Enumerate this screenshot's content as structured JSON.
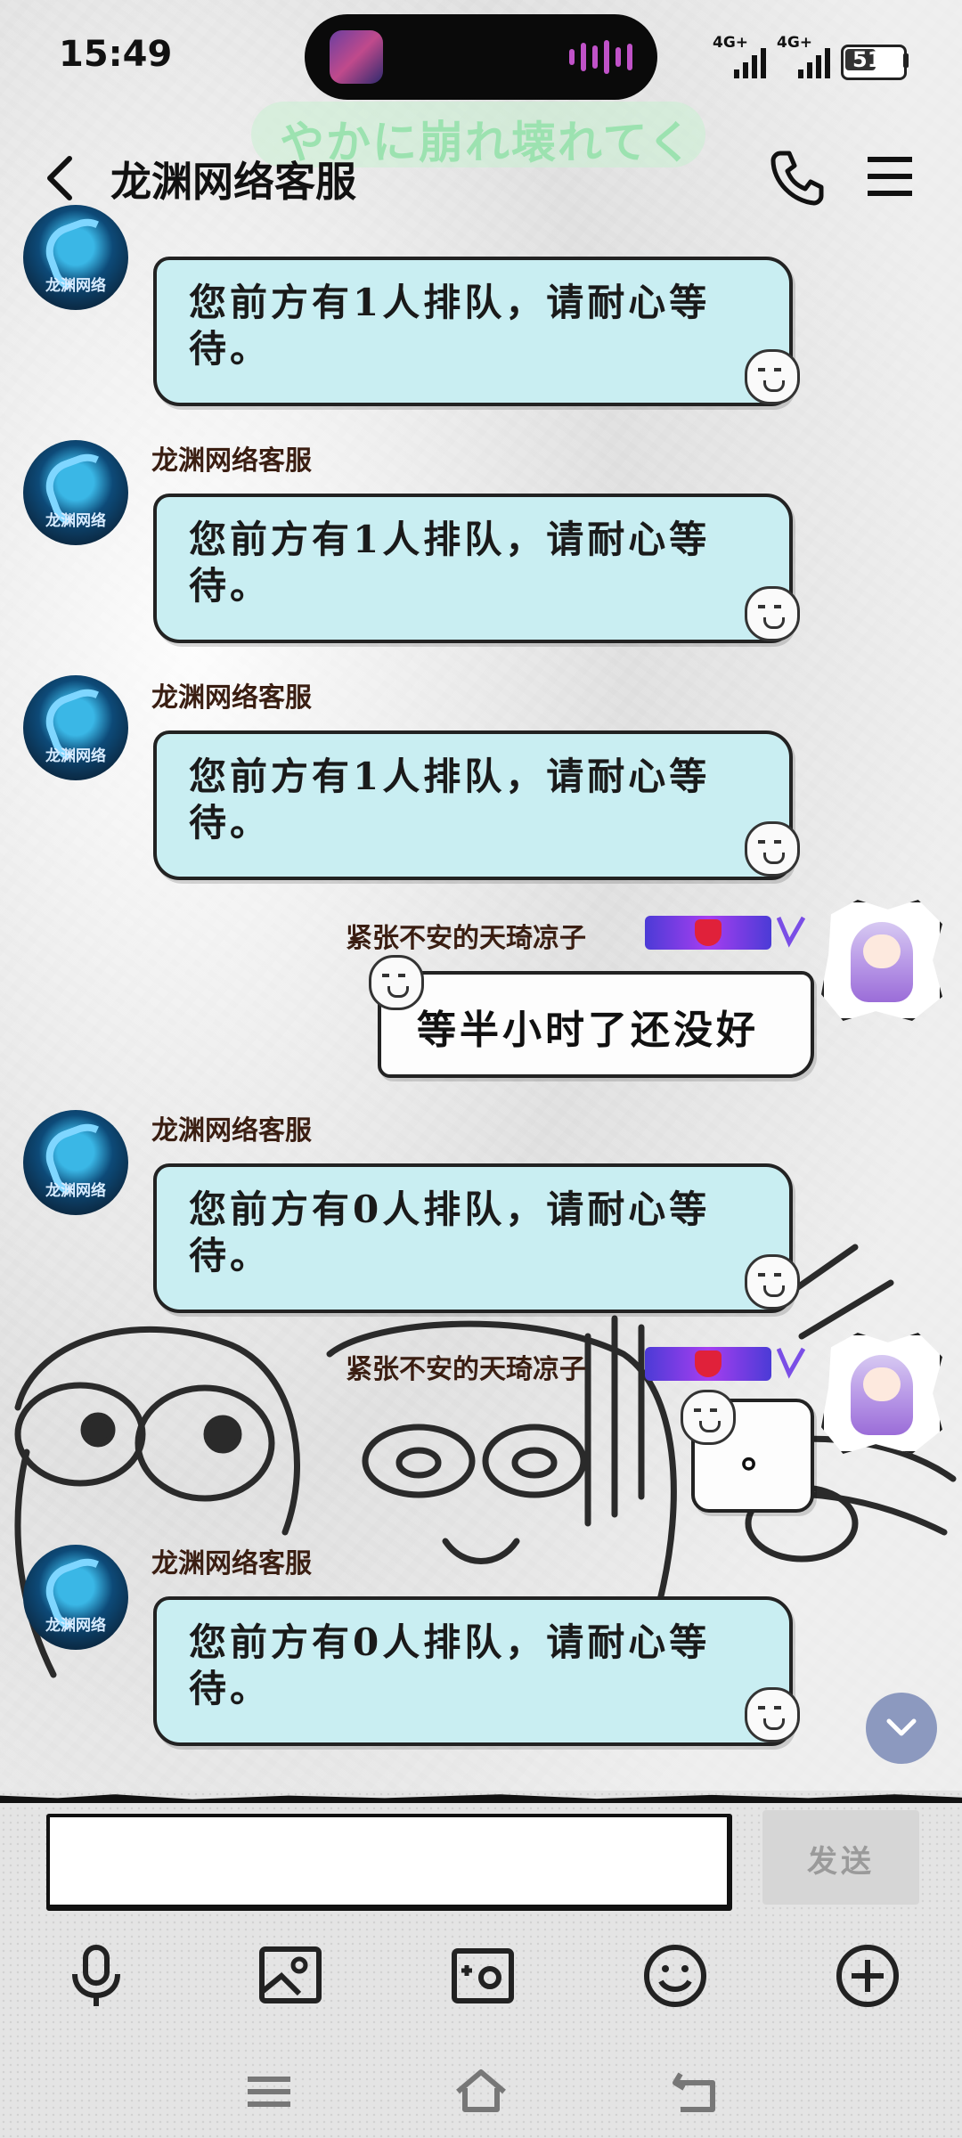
{
  "status_bar": {
    "time": "15:49",
    "sim1_label": "4G+",
    "sim2_label": "4G+",
    "battery": "51"
  },
  "lyric_overlay": "やかに崩れ壊れてく",
  "header": {
    "title": "龙渊网络客服",
    "back_icon": "chevron-left-icon",
    "call_icon": "phone-icon",
    "menu_icon": "hamburger-menu-icon"
  },
  "messages": [
    {
      "side": "left",
      "sender": "",
      "text": "您前方有1人排队，请耐心等待。"
    },
    {
      "side": "left",
      "sender": "龙渊网络客服",
      "text": "您前方有1人排队，请耐心等待。"
    },
    {
      "side": "left",
      "sender": "龙渊网络客服",
      "text": "您前方有1人排队，请耐心等待。"
    },
    {
      "side": "right",
      "sender": "紧张不安的天琦凉子",
      "text": "等半小时了还没好"
    },
    {
      "side": "left",
      "sender": "龙渊网络客服",
      "text": "您前方有0人排队，请耐心等待。"
    },
    {
      "side": "right",
      "sender": "紧张不安的天琦凉子",
      "text": "。"
    },
    {
      "side": "left",
      "sender": "龙渊网络客服",
      "text": "您前方有0人排队，请耐心等待。"
    }
  ],
  "avatar_caption": "龙渊网络",
  "input": {
    "placeholder": "",
    "send_label": "发送"
  },
  "toolbar": [
    "microphone-icon",
    "image-icon",
    "camera-icon",
    "emoji-icon",
    "plus-icon"
  ],
  "nav": [
    "recents-icon",
    "home-icon",
    "back-icon"
  ],
  "colors": {
    "bubble_left": "#c9eef2",
    "bubble_right": "#fdfdfd",
    "sender_name": "#3a1e12",
    "scroll_button": "#8c99bf"
  }
}
